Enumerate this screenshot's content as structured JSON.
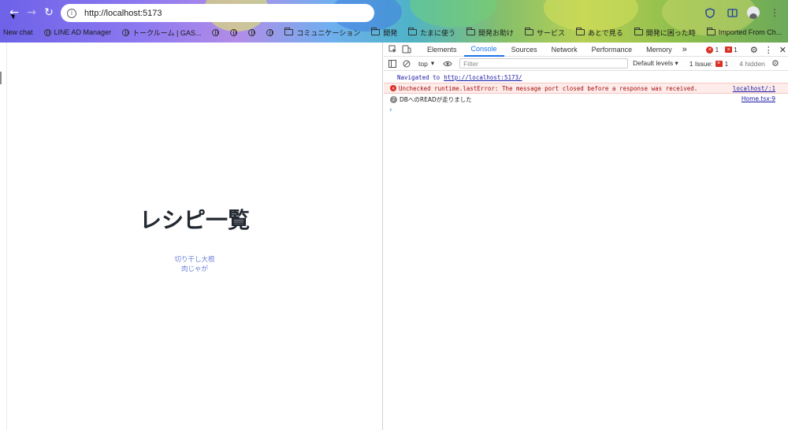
{
  "browser": {
    "url": "http://localhost:5173",
    "nav_back": "←",
    "nav_forward": "→",
    "nav_reload": "↻"
  },
  "bookmarks": [
    {
      "label": "New chat",
      "icon": "none"
    },
    {
      "label": "LINE AD Manager",
      "icon": "globe"
    },
    {
      "label": "トークルーム | GAS...",
      "icon": "globe"
    },
    {
      "label": "",
      "icon": "globe"
    },
    {
      "label": "",
      "icon": "globe"
    },
    {
      "label": "",
      "icon": "globe"
    },
    {
      "label": "",
      "icon": "globe"
    },
    {
      "label": "コミュニケーション",
      "icon": "folder"
    },
    {
      "label": "開発",
      "icon": "folder"
    },
    {
      "label": "たまに使う",
      "icon": "folder"
    },
    {
      "label": "開発お助け",
      "icon": "folder"
    },
    {
      "label": "サービス",
      "icon": "folder"
    },
    {
      "label": "あとで見る",
      "icon": "folder"
    },
    {
      "label": "開発に困った時",
      "icon": "folder"
    },
    {
      "label": "Imported From Ch...",
      "icon": "folder"
    }
  ],
  "page": {
    "title": "レシピ一覧",
    "recipes": [
      "切り干し大根",
      "肉じゃが"
    ]
  },
  "devtools": {
    "tabs": [
      "Elements",
      "Console",
      "Sources",
      "Network",
      "Performance",
      "Memory"
    ],
    "active_tab": "Console",
    "more_tabs": "»",
    "error_count": "1",
    "warning_count": "1",
    "context": "top",
    "filter_placeholder": "Filter",
    "levels": "Default levels ▾",
    "issues_label": "1 Issue:",
    "issues_count": "1",
    "hidden_label": "4 hidden",
    "console": {
      "navigated_prefix": "Navigated to",
      "navigated_url": "http://localhost:5173/",
      "error_msg": "Unchecked runtime.lastError: The message port closed before a response was received.",
      "error_src": "localhost/:1",
      "log_count": "2",
      "log_msg": "DBへのREADが走りました",
      "log_src": "Home.tsx:9",
      "prompt": "›"
    }
  }
}
